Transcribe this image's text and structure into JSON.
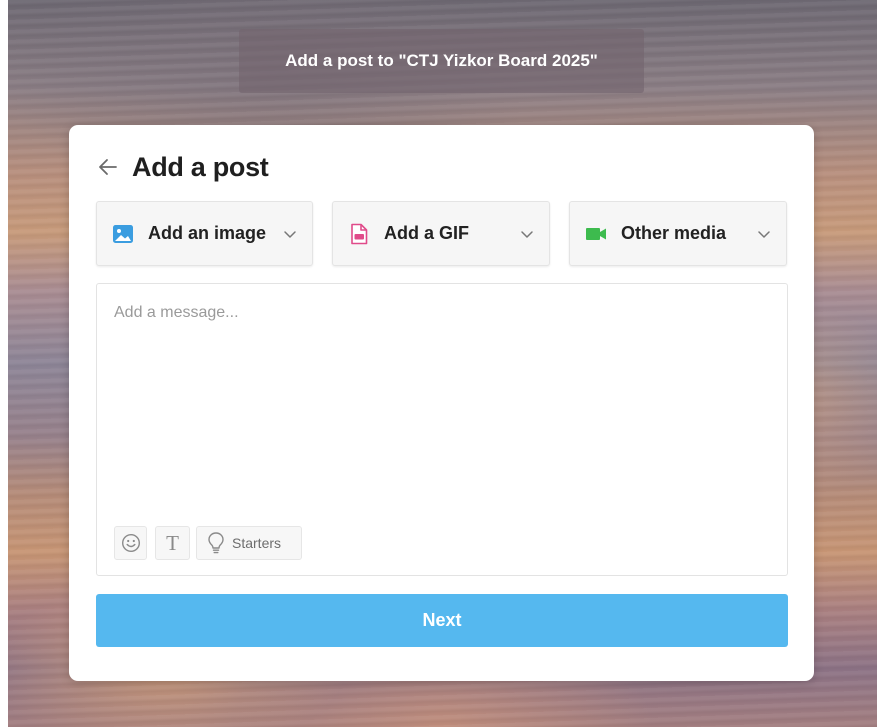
{
  "banner": {
    "text": "Add a post to  \"CTJ Yizkor Board 2025\""
  },
  "header": {
    "title": "Add a post",
    "back_icon": "arrow-left-icon"
  },
  "media_options": {
    "image": {
      "label": "Add an image",
      "icon": "image-icon",
      "icon_color": "#3b9de0"
    },
    "gif": {
      "label": "Add a GIF",
      "icon": "gif-file-icon",
      "icon_color": "#e04b8a"
    },
    "other": {
      "label": "Other media",
      "icon": "video-camera-icon",
      "icon_color": "#3dbb4e"
    }
  },
  "message": {
    "placeholder": "Add a message...",
    "value": ""
  },
  "toolbar": {
    "emoji_icon": "smiley-icon",
    "text_label": "T",
    "starters_label": "Starters",
    "starters_icon": "lightbulb-icon"
  },
  "actions": {
    "next_label": "Next"
  },
  "colors": {
    "accent": "#55b8ef"
  }
}
